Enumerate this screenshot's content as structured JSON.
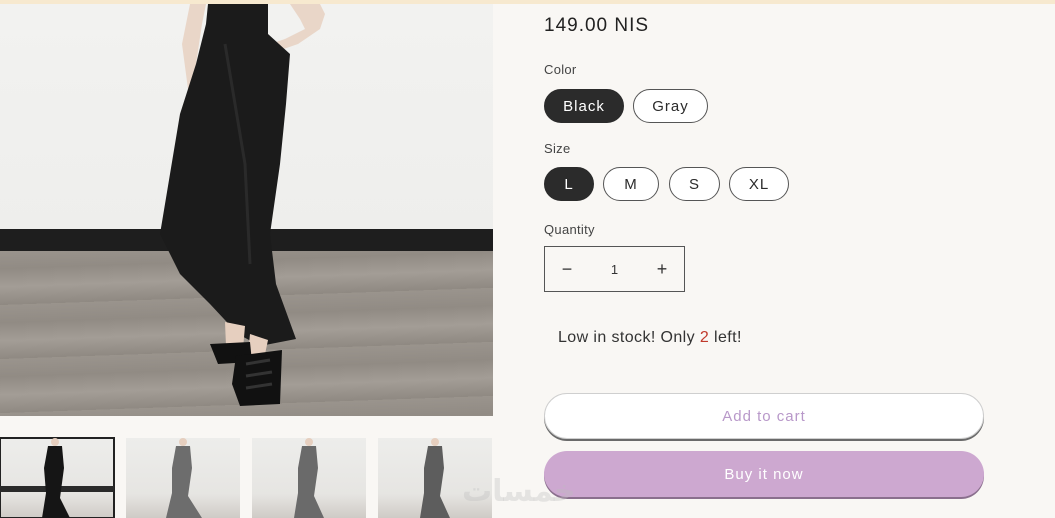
{
  "product": {
    "price": "149.00 NIS"
  },
  "color": {
    "label": "Color",
    "options": [
      "Black",
      "Gray"
    ],
    "selected": "Black"
  },
  "size": {
    "label": "Size",
    "options": [
      "L",
      "M",
      "S",
      "XL"
    ],
    "selected": "L"
  },
  "quantity": {
    "label": "Quantity",
    "value": "1",
    "decrease_symbol": "−",
    "increase_symbol": "+"
  },
  "stock": {
    "prefix": "Low in stock! Only ",
    "count": "2",
    "suffix": " left!"
  },
  "actions": {
    "add_to_cart": "Add to cart",
    "buy_now": "Buy it now"
  },
  "watermark": "خمسات",
  "colors": {
    "background": "#f9f7f4",
    "selected_pill": "#2b2b2b",
    "buy_button": "#cda8d0",
    "cart_text": "#b898c9",
    "stock_count": "#c0392b"
  }
}
